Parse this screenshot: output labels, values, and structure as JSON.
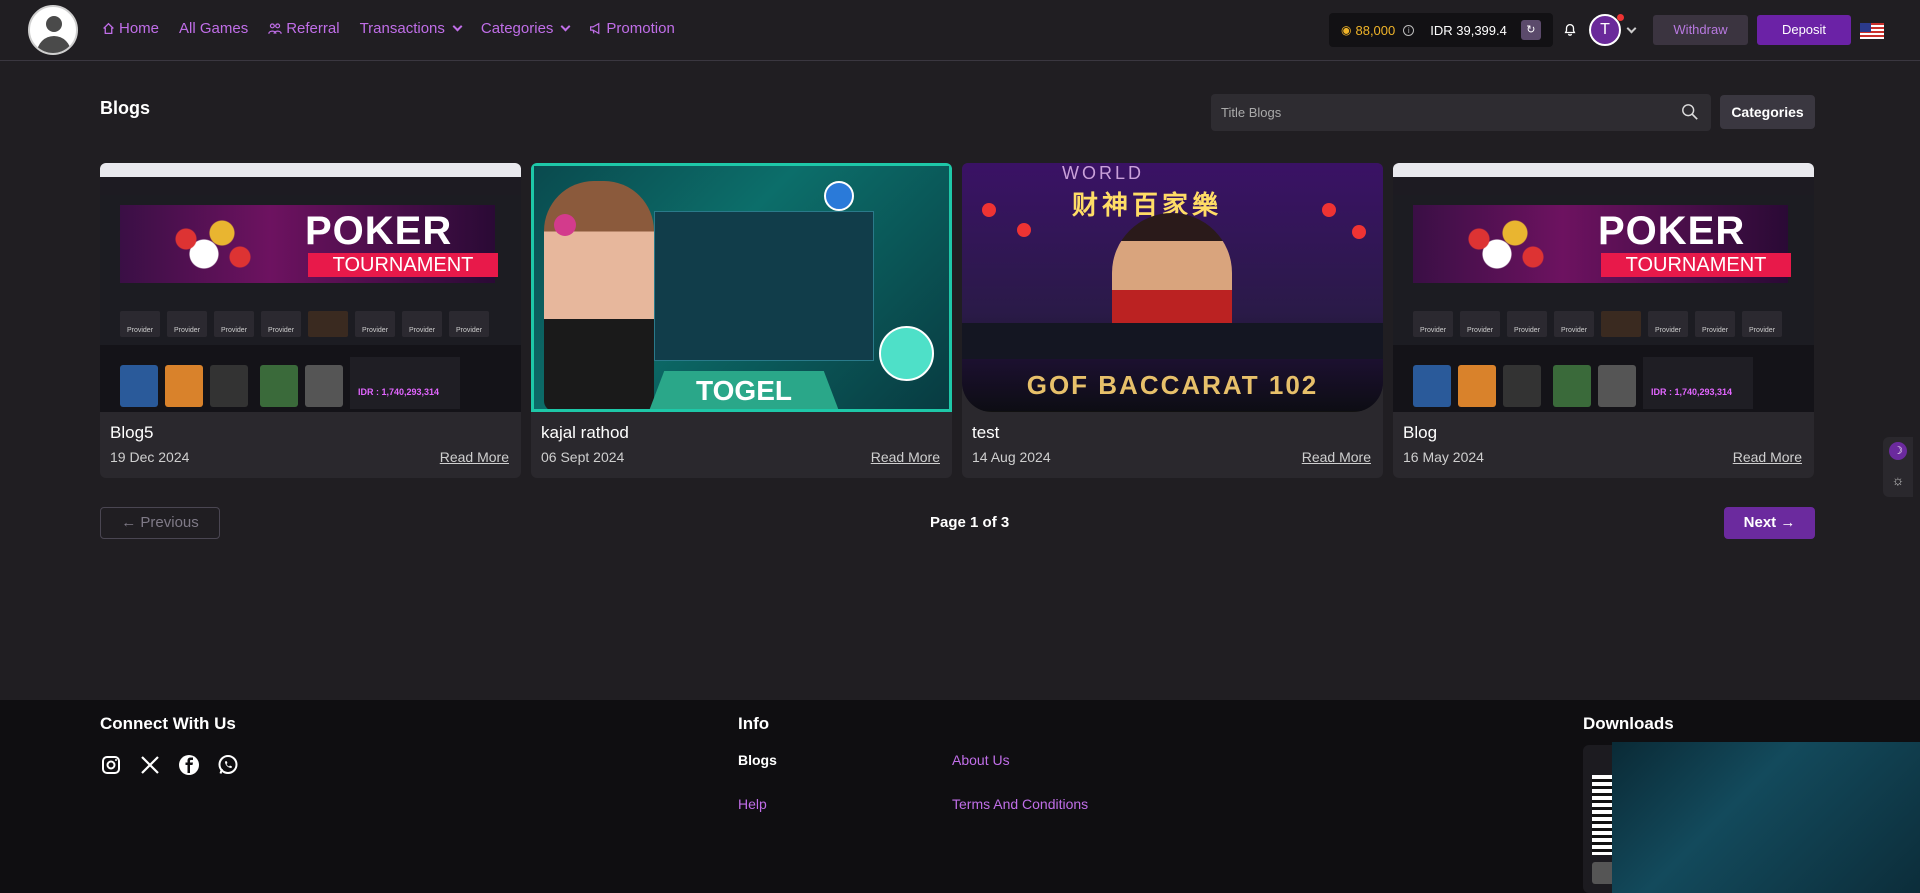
{
  "nav": {
    "home": "Home",
    "all_games": "All Games",
    "referral": "Referral",
    "transactions": "Transactions",
    "categories": "Categories",
    "promotion": "Promotion"
  },
  "wallet": {
    "points": "88,000",
    "info": "i",
    "balance": "IDR 39,399.4"
  },
  "user": {
    "initial": "T"
  },
  "header_buttons": {
    "withdraw": "Withdraw",
    "deposit": "Deposit"
  },
  "page": {
    "title": "Blogs",
    "search_placeholder": "Title Blogs",
    "categories_button": "Categories"
  },
  "blogs": [
    {
      "title": "Blog5",
      "date": "19 Dec 2024",
      "read_more": "Read More",
      "image": "poker-tournament"
    },
    {
      "title": "kajal rathod",
      "date": "06 Sept 2024",
      "read_more": "Read More",
      "image": "togel"
    },
    {
      "title": "test",
      "date": "14 Aug 2024",
      "read_more": "Read More",
      "image": "gof-baccarat-102"
    },
    {
      "title": "Blog",
      "date": "16 May 2024",
      "read_more": "Read More",
      "image": "poker-tournament"
    }
  ],
  "thumbs": {
    "poker_line1": "POKER",
    "poker_line2": "TOURNAMENT",
    "provider": "Provider",
    "jackpot": "IDR : 1,740,293,314",
    "togel": "TOGEL",
    "bacc_top": "WORLD",
    "bacc_cn": "财神百家樂",
    "bacc_bottom": "GOF BACCARAT 102"
  },
  "pagination": {
    "previous": "Previous",
    "page_info": "Page 1 of 3",
    "next": "Next"
  },
  "footer": {
    "connect_heading": "Connect With Us",
    "info_heading": "Info",
    "downloads_heading": "Downloads",
    "links": {
      "blogs": "Blogs",
      "about_us": "About Us",
      "help": "Help",
      "terms": "Terms And Conditions"
    }
  },
  "colors": {
    "accent": "#c06ee8",
    "primary": "#6b22a6",
    "background": "#201e22",
    "gold": "#f0b429"
  }
}
